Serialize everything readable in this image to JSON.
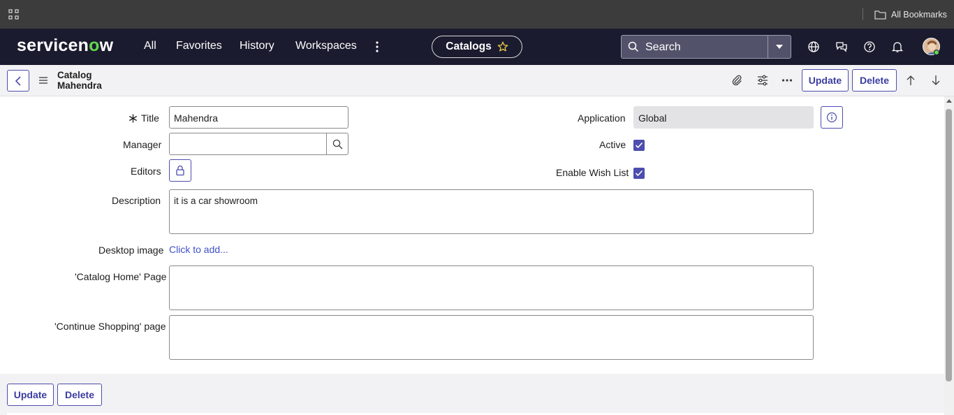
{
  "browser": {
    "bookmarks_label": "All Bookmarks"
  },
  "header": {
    "logo_text_a": "servicen",
    "logo_text_o": "o",
    "logo_text_b": "w",
    "nav": [
      "All",
      "Favorites",
      "History",
      "Workspaces"
    ],
    "context_pill": "Catalogs",
    "search_label": "Search",
    "accent_color": "#62d84e"
  },
  "title_bar": {
    "record_type": "Catalog",
    "record_name": "Mahendra",
    "update_label": "Update",
    "delete_label": "Delete"
  },
  "form": {
    "title_label": "Title",
    "title_value": "Mahendra",
    "manager_label": "Manager",
    "manager_value": "",
    "editors_label": "Editors",
    "application_label": "Application",
    "application_value": "Global",
    "active_label": "Active",
    "active_checked": true,
    "wishlist_label": "Enable Wish List",
    "wishlist_checked": true,
    "description_label": "Description",
    "description_value": "it is a car showroom",
    "desktop_image_label": "Desktop image",
    "desktop_image_link": "Click to add...",
    "catalog_home_label": "'Catalog Home' Page",
    "catalog_home_value": "",
    "continue_shopping_label": "'Continue Shopping' page",
    "continue_shopping_value": ""
  },
  "footer": {
    "update_label": "Update",
    "delete_label": "Delete"
  },
  "colors": {
    "primary_button": "#4c4dae",
    "header_bg": "#1a1b2e",
    "link": "#3f51c8"
  }
}
